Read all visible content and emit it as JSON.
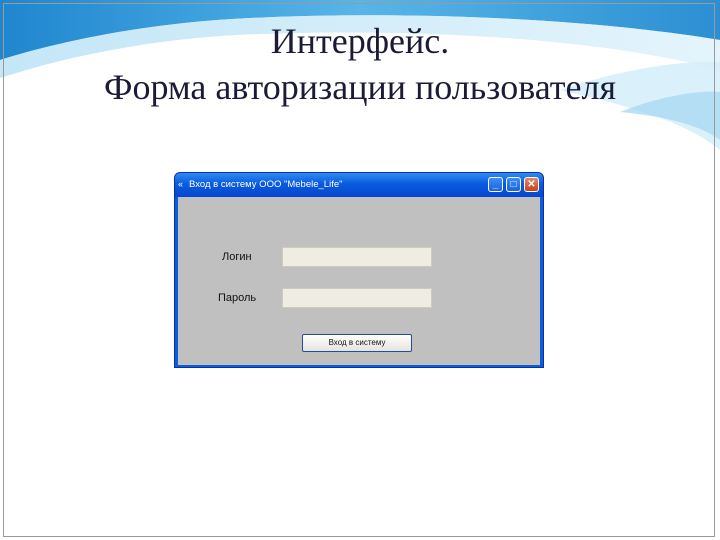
{
  "slide": {
    "title_line1": "Интерфейс.",
    "title_line2": "Форма авторизации пользователя"
  },
  "window": {
    "title": "Вход в систему ООО \"Mebele_Life\"",
    "icon": "window-app-icon",
    "minimize_icon": "minimize-icon",
    "maximize_icon": "maximize-icon",
    "close_icon": "close-icon"
  },
  "form": {
    "login_label": "Логин",
    "login_value": "",
    "password_label": "Пароль",
    "password_value": "",
    "submit_label": "Вход в систему"
  },
  "colors": {
    "titlebar": "#0b5be0",
    "client_bg": "#c0c0c0",
    "field_bg": "#eeece3",
    "title_text": "#1b1b38",
    "swoosh": "#4aa6de"
  }
}
